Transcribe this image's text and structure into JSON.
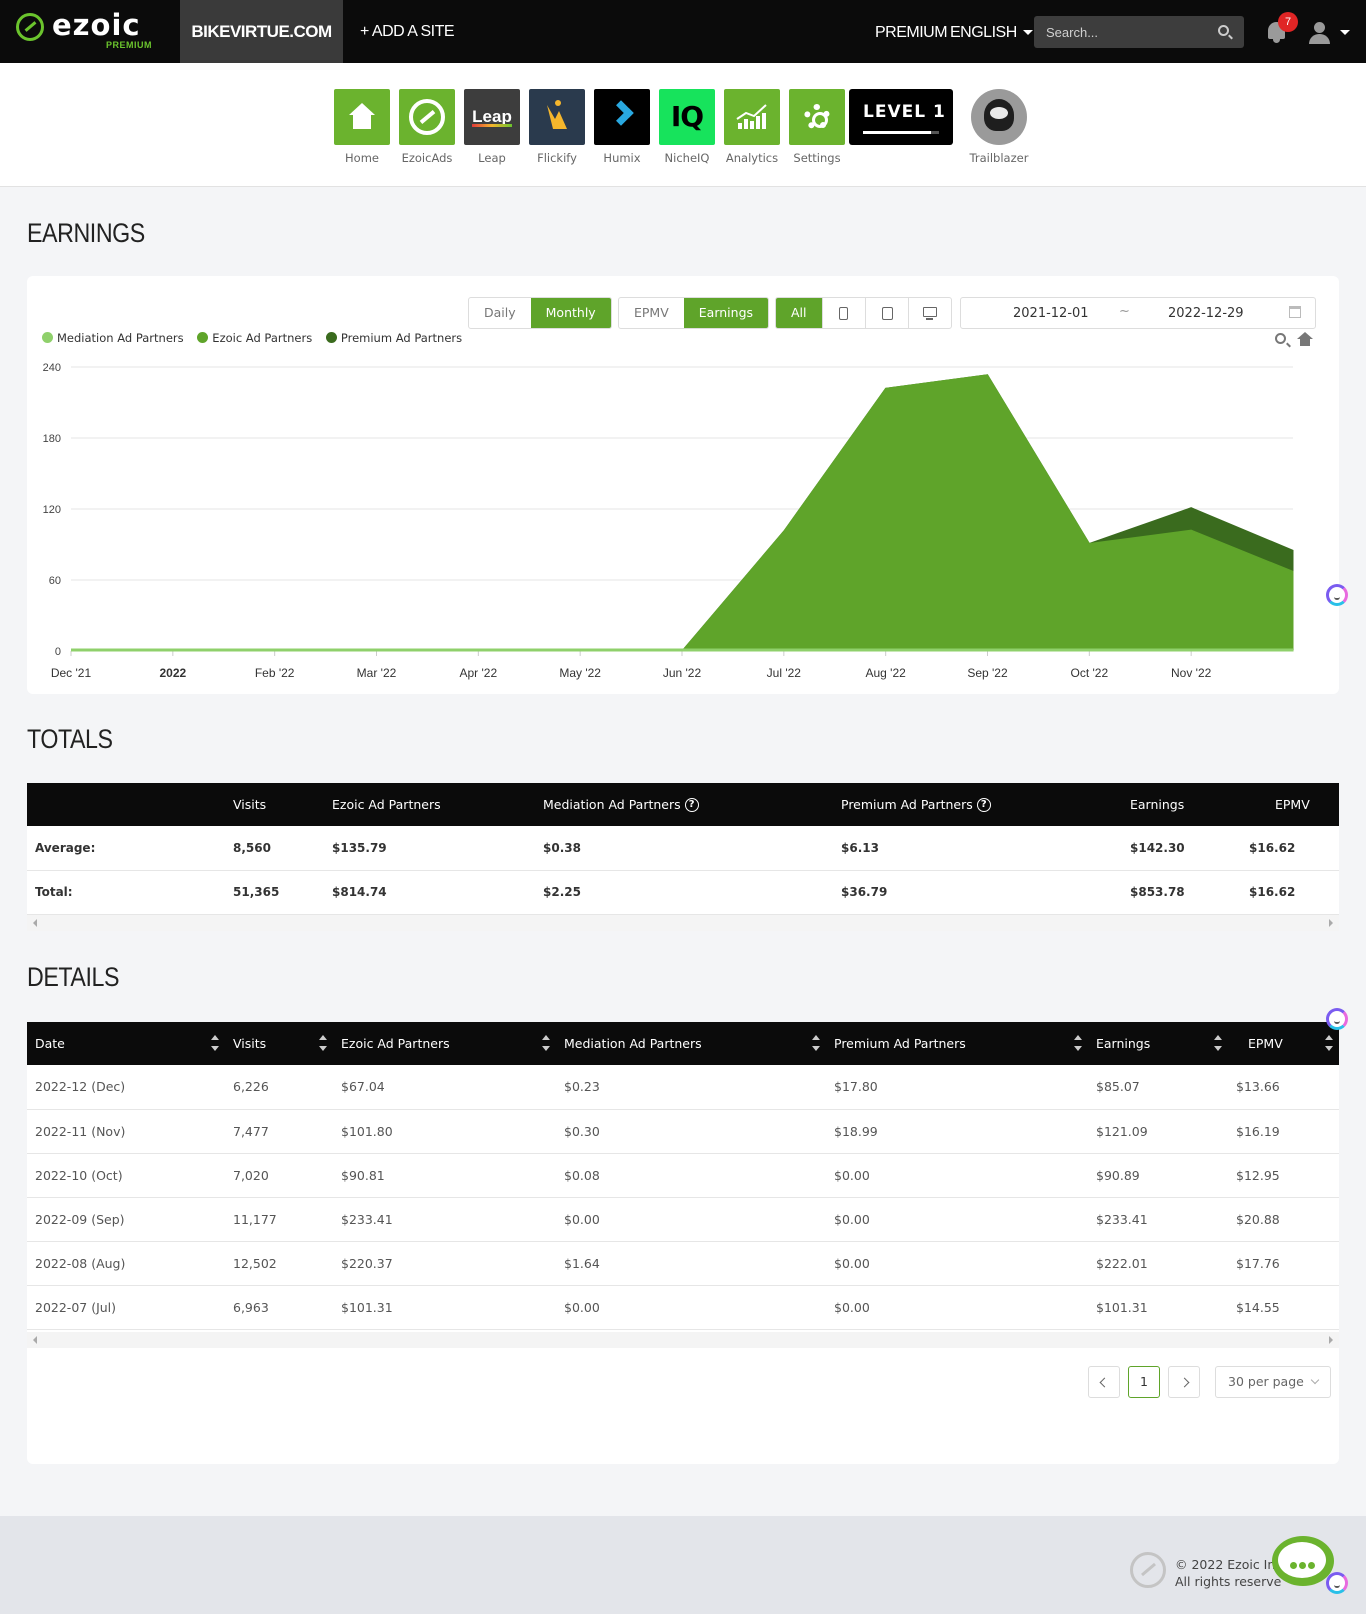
{
  "topbar": {
    "logo_text": "ezoic",
    "logo_sub": "PREMIUM",
    "site": "BIKEVIRTUE.COM",
    "add_site": "+ ADD A SITE",
    "premium": "PREMIUM",
    "language": "ENGLISH",
    "search_placeholder": "Search...",
    "notifications": "7"
  },
  "apps": [
    {
      "label": "Home",
      "icon": "home-icon"
    },
    {
      "label": "EzoicAds",
      "icon": "ezoic-ads-icon"
    },
    {
      "label": "Leap",
      "icon": "leap-icon",
      "tile_text": "Leap"
    },
    {
      "label": "Flickify",
      "icon": "flickify-icon"
    },
    {
      "label": "Humix",
      "icon": "humix-icon"
    },
    {
      "label": "NicheIQ",
      "icon": "nicheiq-icon",
      "tile_text": "IQ"
    },
    {
      "label": "Analytics",
      "icon": "analytics-icon"
    },
    {
      "label": "Settings",
      "icon": "gear-icon"
    }
  ],
  "level": {
    "text": "LEVEL 1",
    "progress": 0.9
  },
  "trailblazer": {
    "label": "Trailblazer"
  },
  "earnings": {
    "title": "EARNINGS",
    "period_buttons": [
      "Daily",
      "Monthly"
    ],
    "active_period": "Monthly",
    "metric_buttons": [
      "EPMV",
      "Earnings"
    ],
    "active_metric": "Earnings",
    "device_all": "All",
    "date_from": "2021-12-01",
    "date_sep": "~",
    "date_to": "2022-12-29"
  },
  "chart_data": {
    "type": "area",
    "stacked": true,
    "x": [
      "Dec '21",
      "2022",
      "Feb '22",
      "Mar '22",
      "Apr '22",
      "May '22",
      "Jun '22",
      "Jul '22",
      "Aug '22",
      "Sep '22",
      "Oct '22",
      "Nov '22",
      "Dec '22"
    ],
    "x_ticks": [
      "Dec '21",
      "2022",
      "Feb '22",
      "Mar '22",
      "Apr '22",
      "May '22",
      "Jun '22",
      "Jul '22",
      "Aug '22",
      "Sep '22",
      "Oct '22",
      "Nov '22"
    ],
    "y_ticks": [
      0,
      60,
      120,
      180,
      240
    ],
    "ylim": [
      0,
      240
    ],
    "grid": true,
    "legend_position": "top-left",
    "series": [
      {
        "name": "Mediation Ad Partners",
        "color": "#8fd06b",
        "values": [
          0,
          0,
          0,
          0,
          0,
          0,
          0,
          0,
          1.64,
          0,
          0.08,
          0.3,
          0.23
        ]
      },
      {
        "name": "Ezoic Ad Partners",
        "color": "#5fa42a",
        "values": [
          0,
          0,
          0,
          0,
          0,
          0,
          0,
          101.31,
          220.37,
          233.41,
          90.81,
          101.8,
          67.04
        ]
      },
      {
        "name": "Premium Ad Partners",
        "color": "#3a6b1e",
        "values": [
          0,
          0,
          0,
          0,
          0,
          0,
          0,
          0,
          0,
          0,
          0,
          18.99,
          17.8
        ]
      }
    ]
  },
  "totals": {
    "title": "TOTALS",
    "headers": [
      "",
      "Visits",
      "Ezoic Ad Partners",
      "Mediation Ad Partners",
      "Premium Ad Partners",
      "Earnings",
      "EPMV"
    ],
    "rows": [
      [
        "Average:",
        "8,560",
        "$135.79",
        "$0.38",
        "$6.13",
        "$142.30",
        "$16.62"
      ],
      [
        "Total:",
        "51,365",
        "$814.74",
        "$2.25",
        "$36.79",
        "$853.78",
        "$16.62"
      ]
    ]
  },
  "details": {
    "title": "DETAILS",
    "headers": [
      "Date",
      "Visits",
      "Ezoic Ad Partners",
      "Mediation Ad Partners",
      "Premium Ad Partners",
      "Earnings",
      "EPMV"
    ],
    "rows": [
      [
        "2022-12 (Dec)",
        "6,226",
        "$67.04",
        "$0.23",
        "$17.80",
        "$85.07",
        "$13.66"
      ],
      [
        "2022-11 (Nov)",
        "7,477",
        "$101.80",
        "$0.30",
        "$18.99",
        "$121.09",
        "$16.19"
      ],
      [
        "2022-10 (Oct)",
        "7,020",
        "$90.81",
        "$0.08",
        "$0.00",
        "$90.89",
        "$12.95"
      ],
      [
        "2022-09 (Sep)",
        "11,177",
        "$233.41",
        "$0.00",
        "$0.00",
        "$233.41",
        "$20.88"
      ],
      [
        "2022-08 (Aug)",
        "12,502",
        "$220.37",
        "$1.64",
        "$0.00",
        "$222.01",
        "$17.76"
      ],
      [
        "2022-07 (Jul)",
        "6,963",
        "$101.31",
        "$0.00",
        "$0.00",
        "$101.31",
        "$14.55"
      ]
    ],
    "page": "1",
    "per_page": "30 per page"
  },
  "footer": {
    "line1": "© 2022 Ezoic Inc",
    "line2": "All rights reserve"
  }
}
